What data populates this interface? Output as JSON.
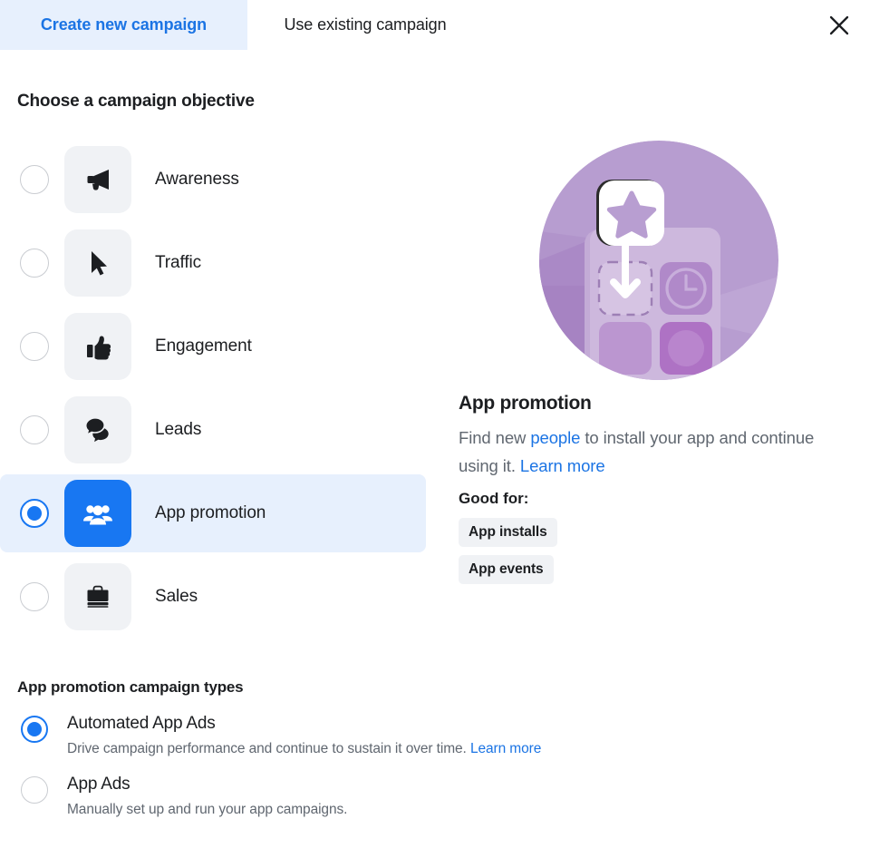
{
  "tabs": [
    {
      "label": "Create new campaign",
      "active": true,
      "name": "tab-create-new-campaign"
    },
    {
      "label": "Use existing campaign",
      "active": false,
      "name": "tab-use-existing-campaign"
    }
  ],
  "close_icon": "close-icon",
  "objective_section": {
    "title": "Choose a campaign objective",
    "items": [
      {
        "label": "Awareness",
        "icon": "megaphone-icon",
        "selected": false
      },
      {
        "label": "Traffic",
        "icon": "cursor-icon",
        "selected": false
      },
      {
        "label": "Engagement",
        "icon": "thumbs-up-icon",
        "selected": false
      },
      {
        "label": "Leads",
        "icon": "speech-bubbles-icon",
        "selected": false
      },
      {
        "label": "App promotion",
        "icon": "people-group-icon",
        "selected": true
      },
      {
        "label": "Sales",
        "icon": "briefcase-icon",
        "selected": false
      }
    ]
  },
  "detail": {
    "illustration": "app-install-illustration",
    "title": "App promotion",
    "description_part1": "Find new ",
    "description_link1": "people",
    "description_part2": " to install your app and continue using it. ",
    "description_link2": "Learn more",
    "good_for_label": "Good for:",
    "badges": [
      "App installs",
      "App events"
    ]
  },
  "campaign_types": {
    "title": "App promotion campaign types",
    "items": [
      {
        "name": "Automated App Ads",
        "desc_text": "Drive campaign performance and continue to sustain it over time. ",
        "desc_link": "Learn more",
        "selected": true
      },
      {
        "name": "App Ads",
        "desc_text": "Manually set up and run your app campaigns.",
        "desc_link": "",
        "selected": false
      }
    ]
  },
  "colors": {
    "accent_blue": "#1877f2",
    "link_blue": "#1b74e4",
    "tab_active_bg": "#e7f0fd",
    "icon_box_bg": "#f0f2f5",
    "text_primary": "#1c1e21",
    "text_secondary": "#606770",
    "illustration_purple": "#b49ccd"
  }
}
